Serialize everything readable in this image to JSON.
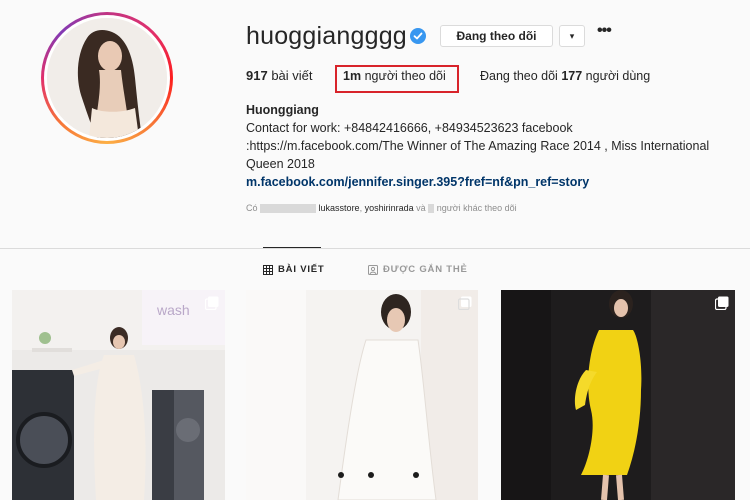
{
  "profile": {
    "username": "huoggiangggg",
    "verified": true,
    "follow_button": "Đang theo dõi",
    "dropdown_icon": "▾",
    "more_icon": "•••",
    "stats": {
      "posts_count": "917",
      "posts_label": "bài viết",
      "followers_count": "1m",
      "followers_label": "người theo dõi",
      "following_prefix": "Đang theo dõi",
      "following_count": "177",
      "following_label": "người dùng"
    },
    "bio": {
      "name": "Huonggiang",
      "line1": "Contact for work: +84842416666, +84934523623 facebook",
      "line2": ":https://m.facebook.com/The Winner of The Amazing Race 2014 , Miss International",
      "line3": "Queen 2018",
      "link": "m.facebook.com/jennifer.singer.395?fref=nf&pn_ref=story"
    },
    "followed_by": {
      "prefix": "Có",
      "user1": "lukasstore",
      "separator": ",",
      "user2": "yoshirinrada",
      "conj": "và",
      "suffix": "người khác theo dõi"
    }
  },
  "tabs": [
    {
      "label": "BÀI VIẾT",
      "icon": "grid-icon",
      "active": true
    },
    {
      "label": "ĐƯỢC GẮN THẺ",
      "icon": "tag-icon",
      "active": false
    }
  ],
  "colors": {
    "verified_blue": "#3897f0",
    "highlight_red": "#d8232a",
    "link_navy": "#003569"
  }
}
